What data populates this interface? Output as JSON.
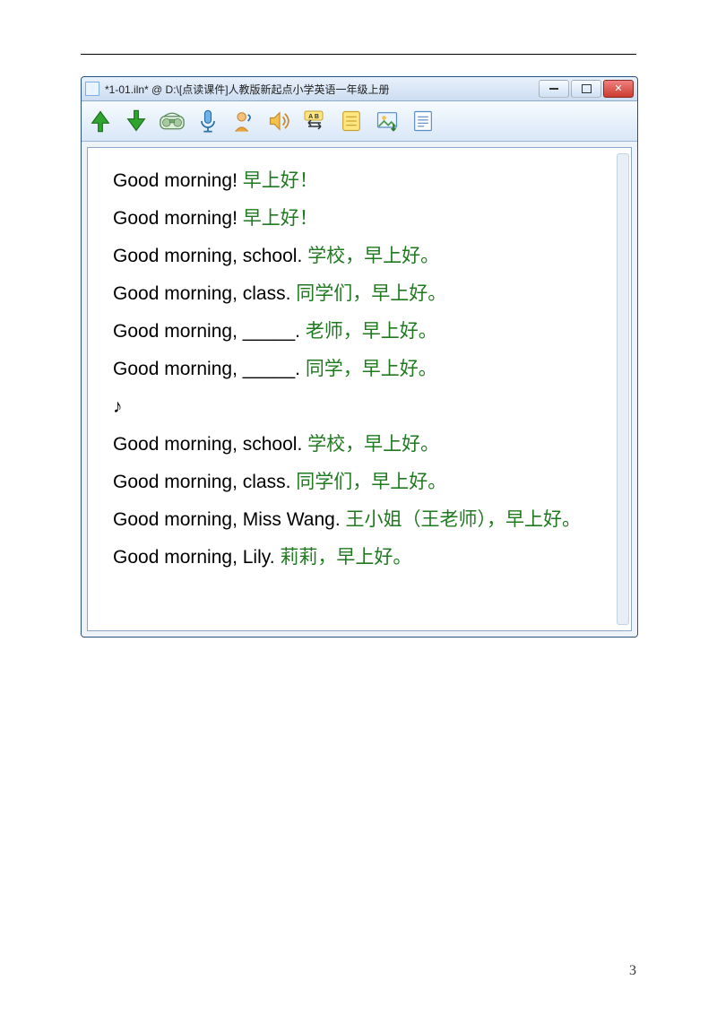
{
  "window": {
    "title": "*1-01.iln* @ D:\\[点读课件]人教版新起点小学英语一年级上册"
  },
  "toolbar_icons": {
    "up": "arrow-up-icon",
    "down": "arrow-down-icon",
    "radio": "boombox-icon",
    "mic": "microphone-icon",
    "person": "person-speaker-icon",
    "speaker": "speaker-icon",
    "abloop": "ab-loop-icon",
    "note": "note-icon",
    "image": "image-icon",
    "textdoc": "text-doc-icon"
  },
  "lines": [
    {
      "en": "Good morning! ",
      "zh": "早上好！"
    },
    {
      "en": "Good morning! ",
      "zh": "早上好！"
    },
    {
      "en": "Good morning, school. ",
      "zh": "学校，早上好。"
    },
    {
      "en": "Good morning, class. ",
      "zh": "同学们，早上好。"
    },
    {
      "en": "Good morning, _____. ",
      "zh": "老师，早上好。"
    },
    {
      "en": "Good morning, _____. ",
      "zh": "同学，早上好。"
    },
    {
      "music": "♪"
    },
    {
      "en": "Good morning, school. ",
      "zh": "学校，早上好。"
    },
    {
      "en": "Good morning, class. ",
      "zh": "同学们，早上好。"
    },
    {
      "en": "Good morning, Miss Wang. ",
      "zh": "王小姐（王老师），早上好。"
    },
    {
      "en": "Good morning, Lily. ",
      "zh": "莉莉，早上好。"
    }
  ],
  "page_number": "3"
}
